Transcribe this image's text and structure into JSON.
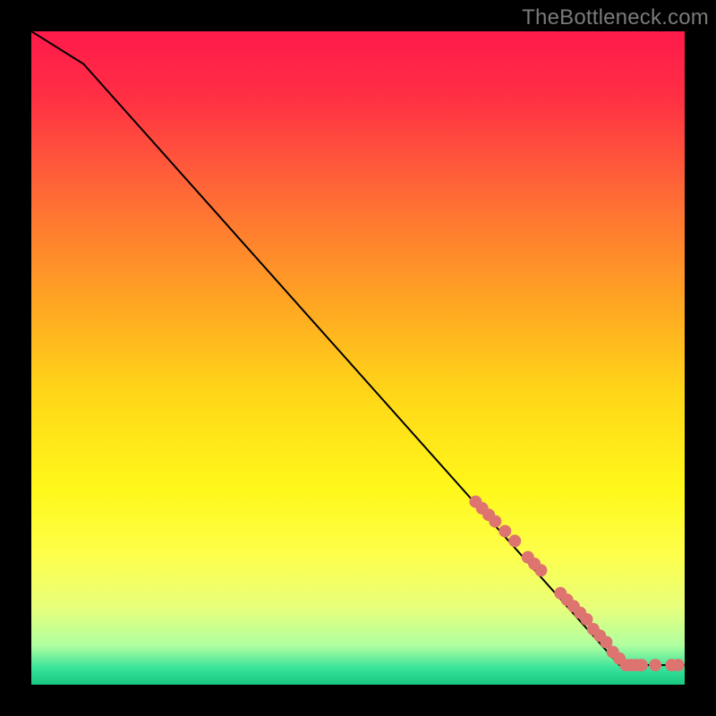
{
  "watermark": "TheBottleneck.com",
  "chart_data": {
    "type": "line",
    "xlim": [
      0,
      100
    ],
    "ylim": [
      0,
      100
    ],
    "line": [
      {
        "x": 0,
        "y": 100
      },
      {
        "x": 8,
        "y": 95
      },
      {
        "x": 90,
        "y": 3
      },
      {
        "x": 100,
        "y": 3
      }
    ],
    "points": [
      {
        "x": 68,
        "y": 28
      },
      {
        "x": 69,
        "y": 27
      },
      {
        "x": 70,
        "y": 26
      },
      {
        "x": 71,
        "y": 25
      },
      {
        "x": 72.5,
        "y": 23.5
      },
      {
        "x": 74,
        "y": 22
      },
      {
        "x": 76,
        "y": 19.5
      },
      {
        "x": 77,
        "y": 18.5
      },
      {
        "x": 78,
        "y": 17.5
      },
      {
        "x": 81,
        "y": 14
      },
      {
        "x": 82,
        "y": 13
      },
      {
        "x": 83,
        "y": 12
      },
      {
        "x": 84,
        "y": 11
      },
      {
        "x": 85,
        "y": 10
      },
      {
        "x": 86,
        "y": 8.5
      },
      {
        "x": 87,
        "y": 7.5
      },
      {
        "x": 88,
        "y": 6.5
      },
      {
        "x": 89,
        "y": 5
      },
      {
        "x": 90,
        "y": 4
      },
      {
        "x": 91,
        "y": 3
      },
      {
        "x": 91.8,
        "y": 3
      },
      {
        "x": 92.6,
        "y": 3
      },
      {
        "x": 93.4,
        "y": 3
      },
      {
        "x": 95.5,
        "y": 3
      },
      {
        "x": 98,
        "y": 3
      },
      {
        "x": 99,
        "y": 3
      }
    ],
    "gradient_stops": [
      {
        "offset": 0.0,
        "color": "#ff1a4b"
      },
      {
        "offset": 0.1,
        "color": "#ff2f44"
      },
      {
        "offset": 0.25,
        "color": "#ff6a36"
      },
      {
        "offset": 0.4,
        "color": "#ffa024"
      },
      {
        "offset": 0.55,
        "color": "#ffd518"
      },
      {
        "offset": 0.7,
        "color": "#fff81a"
      },
      {
        "offset": 0.8,
        "color": "#fdff4a"
      },
      {
        "offset": 0.88,
        "color": "#e9ff7a"
      },
      {
        "offset": 0.94,
        "color": "#b0ffa0"
      },
      {
        "offset": 0.975,
        "color": "#38e39a"
      },
      {
        "offset": 1.0,
        "color": "#18c880"
      }
    ],
    "point_color": "#dd7470",
    "line_color": "#000000"
  }
}
